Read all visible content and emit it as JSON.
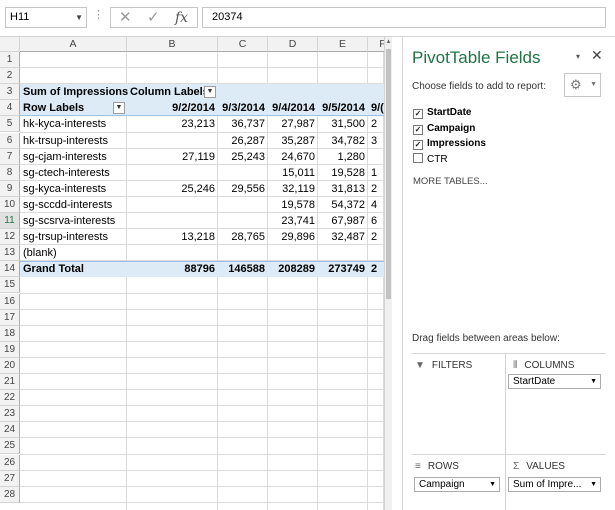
{
  "formula_bar": {
    "name_box": "H11",
    "dots": "⋮",
    "cancel_icon": "✕",
    "enter_icon": "✓",
    "function_icon": "fx",
    "formula_value": "20374"
  },
  "grid": {
    "columns": [
      "A",
      "B",
      "C",
      "D",
      "E",
      "F"
    ],
    "row_numbers": [
      "1",
      "2",
      "3",
      "4",
      "5",
      "6",
      "7",
      "8",
      "9",
      "10",
      "11",
      "12",
      "13",
      "14",
      "15",
      "16",
      "17",
      "18",
      "19",
      "20",
      "21",
      "22",
      "23",
      "24",
      "25",
      "26",
      "27",
      "28"
    ],
    "selected_row": "11"
  },
  "pivot": {
    "value_label": "Sum of Impressions",
    "column_labels": "Column Labels",
    "row_labels": "Row Labels",
    "dates": [
      "9/2/2014",
      "9/3/2014",
      "9/4/2014",
      "9/5/2014",
      "9/("
    ],
    "rows": [
      {
        "label": "hk-kyca-interests",
        "values": [
          "23,213",
          "36,737",
          "27,987",
          "31,500",
          "2"
        ]
      },
      {
        "label": "hk-trsup-interests",
        "values": [
          "",
          "26,287",
          "35,287",
          "34,782",
          "3"
        ]
      },
      {
        "label": "sg-cjam-interests",
        "values": [
          "27,119",
          "25,243",
          "24,670",
          "1,280",
          ""
        ]
      },
      {
        "label": "sg-ctech-interests",
        "values": [
          "",
          "",
          "15,011",
          "19,528",
          "1"
        ]
      },
      {
        "label": "sg-kyca-interests",
        "values": [
          "25,246",
          "29,556",
          "32,119",
          "31,813",
          "2"
        ]
      },
      {
        "label": "sg-sccdd-interests",
        "values": [
          "",
          "",
          "19,578",
          "54,372",
          "4"
        ]
      },
      {
        "label": "sg-scsrva-interests",
        "values": [
          "",
          "",
          "23,741",
          "67,987",
          "6"
        ]
      },
      {
        "label": "sg-trsup-interests",
        "values": [
          "13,218",
          "28,765",
          "29,896",
          "32,487",
          "2"
        ]
      },
      {
        "label": "(blank)",
        "values": [
          "",
          "",
          "",
          "",
          ""
        ]
      }
    ],
    "grand_total": {
      "label": "Grand Total",
      "values": [
        "88796",
        "146588",
        "208289",
        "273749",
        "2"
      ]
    }
  },
  "panel": {
    "title": "PivotTable Fields",
    "menu_icon": "▾",
    "close_icon": "✕",
    "choose_label": "Choose fields to add to report:",
    "gear_icon": "⚙",
    "fields": [
      {
        "label": "StartDate",
        "checked": true
      },
      {
        "label": "Campaign",
        "checked": true
      },
      {
        "label": "Impressions",
        "checked": true
      },
      {
        "label": "CTR",
        "checked": false
      }
    ],
    "check_mark": "✓",
    "more_tables": "MORE TABLES...",
    "drag_label": "Drag fields between areas below:",
    "areas": {
      "filters": {
        "label": "FILTERS",
        "icon": "▼"
      },
      "columns": {
        "label": "COLUMNS",
        "icon": "⦀",
        "item": "StartDate"
      },
      "rows": {
        "label": "ROWS",
        "icon": "≡",
        "item": "Campaign"
      },
      "values": {
        "label": "VALUES",
        "icon": "Σ",
        "item": "Sum of Impre..."
      }
    },
    "dropdown_icon": "▼"
  }
}
